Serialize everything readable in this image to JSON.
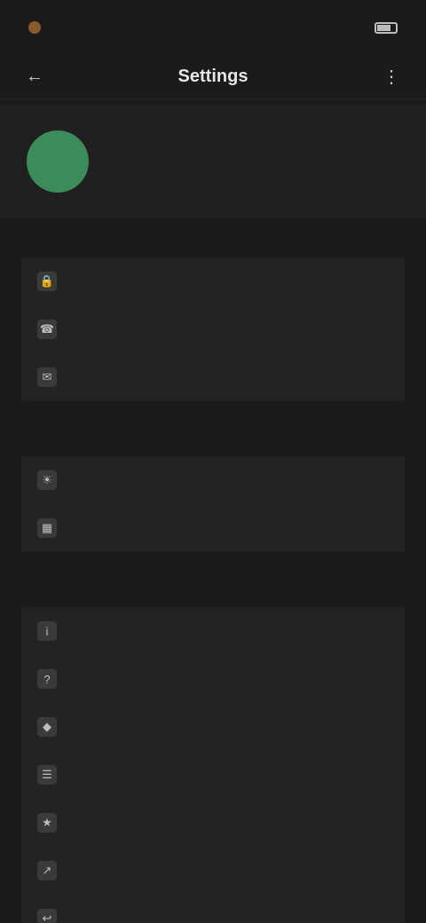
{
  "status": {
    "time": "",
    "right_text": ""
  },
  "app_bar": {
    "title": "Settings"
  },
  "profile": {
    "initials": "",
    "name": "",
    "subtitle": "",
    "subtitle2": ""
  },
  "sections": [
    {
      "label": "",
      "items": [
        {
          "label": "",
          "icon": "lock-icon"
        },
        {
          "label": "",
          "icon": "bell-icon"
        },
        {
          "label": "",
          "icon": "chat-icon"
        }
      ]
    },
    {
      "label": "",
      "items": [
        {
          "label": "",
          "icon": "palette-icon"
        },
        {
          "label": "",
          "icon": "storage-icon"
        }
      ]
    },
    {
      "label": "",
      "items": [
        {
          "label": "",
          "icon": "info-icon"
        },
        {
          "label": "",
          "icon": "help-icon"
        },
        {
          "label": "",
          "icon": "shield-icon"
        },
        {
          "label": "",
          "icon": "document-icon"
        },
        {
          "label": "",
          "icon": "star-icon"
        },
        {
          "label": "",
          "icon": "share-icon"
        },
        {
          "label": "",
          "icon": "logout-icon"
        }
      ]
    }
  ]
}
